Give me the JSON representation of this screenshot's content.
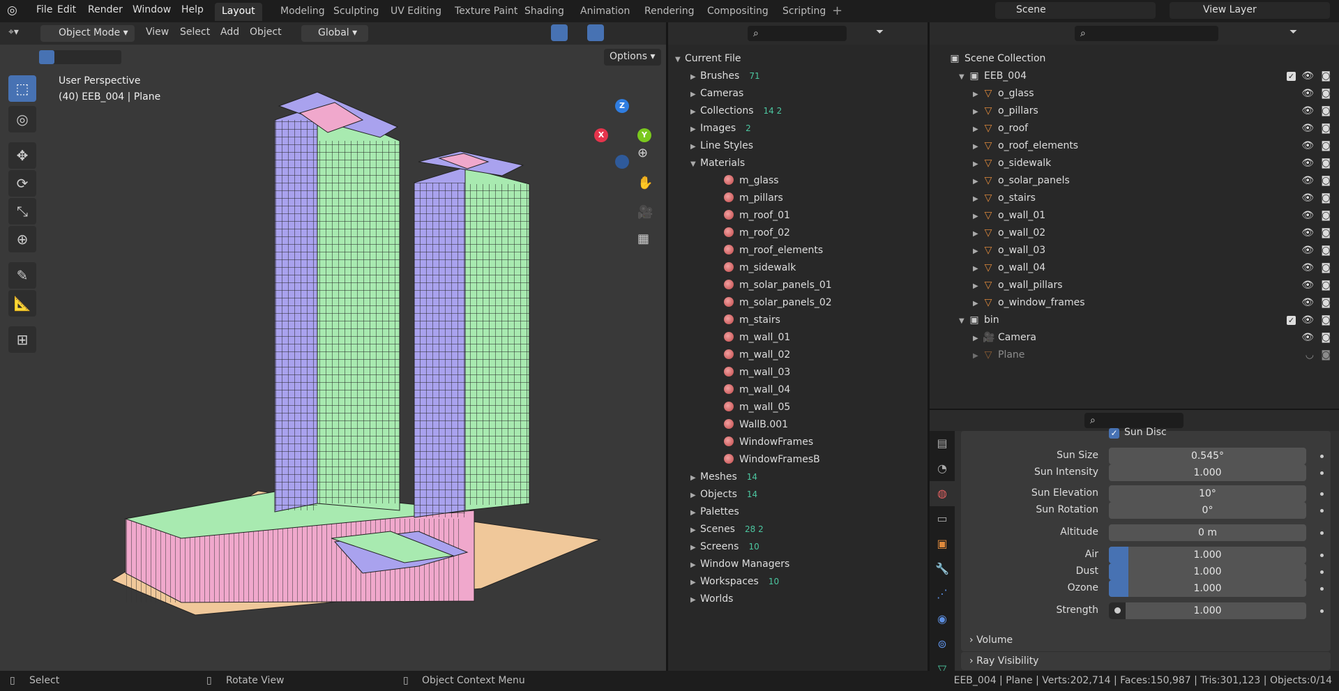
{
  "menu": [
    "File",
    "Edit",
    "Render",
    "Window",
    "Help"
  ],
  "workspaces": [
    "Layout",
    "Modeling",
    "Sculpting",
    "UV Editing",
    "Texture Paint",
    "Shading",
    "Animation",
    "Rendering",
    "Compositing",
    "Scripting"
  ],
  "scene": "Scene",
  "view_layer": "View Layer",
  "viewport": {
    "mode": "Object Mode",
    "menus": [
      "View",
      "Select",
      "Add",
      "Object"
    ],
    "orientation": "Global",
    "options": "Options",
    "perspective": "User Perspective",
    "object_info": "(40) EEB_004 | Plane",
    "gizmo": {
      "x": "X",
      "y": "Y",
      "z": "Z"
    }
  },
  "outliner_file": {
    "root": "Current File",
    "items": [
      {
        "label": "Brushes",
        "count": "71",
        "open": false
      },
      {
        "label": "Cameras",
        "count": "",
        "open": false
      },
      {
        "label": "Collections",
        "count": "14  2",
        "open": false
      },
      {
        "label": "Images",
        "count": "2",
        "open": false
      },
      {
        "label": "Line Styles",
        "count": "",
        "open": false
      },
      {
        "label": "Materials",
        "count": "",
        "open": true
      }
    ],
    "materials": [
      "m_glass",
      "m_pillars",
      "m_roof_01",
      "m_roof_02",
      "m_roof_elements",
      "m_sidewalk",
      "m_solar_panels_01",
      "m_solar_panels_02",
      "m_stairs",
      "m_wall_01",
      "m_wall_02",
      "m_wall_03",
      "m_wall_04",
      "m_wall_05",
      "WallB.001",
      "WindowFrames",
      "WindowFramesB"
    ],
    "after": [
      {
        "label": "Meshes",
        "count": "14"
      },
      {
        "label": "Objects",
        "count": "14"
      },
      {
        "label": "Palettes",
        "count": ""
      },
      {
        "label": "Scenes",
        "count": "28  2"
      },
      {
        "label": "Screens",
        "count": "10"
      },
      {
        "label": "Window Managers",
        "count": ""
      },
      {
        "label": "Workspaces",
        "count": "10"
      },
      {
        "label": "Worlds",
        "count": ""
      }
    ]
  },
  "outliner_scene": {
    "root": "Scene Collection",
    "collection": "EEB_004",
    "objects": [
      "o_glass",
      "o_pillars",
      "o_roof",
      "o_roof_elements",
      "o_sidewalk",
      "o_solar_panels",
      "o_stairs",
      "o_wall_01",
      "o_wall_02",
      "o_wall_03",
      "o_wall_04",
      "o_wall_pillars",
      "o_window_frames"
    ],
    "bin": "bin",
    "bin_items": [
      "Camera",
      "Plane"
    ]
  },
  "properties": {
    "sun_disc": "Sun Disc",
    "fields": [
      {
        "label": "Sun Size",
        "value": "0.545°"
      },
      {
        "label": "Sun Intensity",
        "value": "1.000"
      },
      {
        "label": "Sun Elevation",
        "value": "10°"
      },
      {
        "label": "Sun Rotation",
        "value": "0°"
      },
      {
        "label": "Altitude",
        "value": "0 m"
      },
      {
        "label": "Air",
        "value": "1.000",
        "fill": 0.1
      },
      {
        "label": "Dust",
        "value": "1.000",
        "fill": 0.1
      },
      {
        "label": "Ozone",
        "value": "1.000",
        "fill": 0.1
      },
      {
        "label": "Strength",
        "value": "1.000"
      }
    ],
    "panels": [
      "Volume",
      "Ray Visibility"
    ]
  },
  "status": {
    "select": "Select",
    "rotate": "Rotate View",
    "context": "Object Context Menu",
    "stats": "EEB_004 | Plane | Verts:202,714 | Faces:150,987 | Tris:301,123 | Objects:0/14"
  },
  "colors": {
    "accent": "#4772b3",
    "green": "#a8eab0",
    "purple": "#a9a2ee",
    "pink": "#f0a8cc",
    "ground": "#f0c89a"
  }
}
